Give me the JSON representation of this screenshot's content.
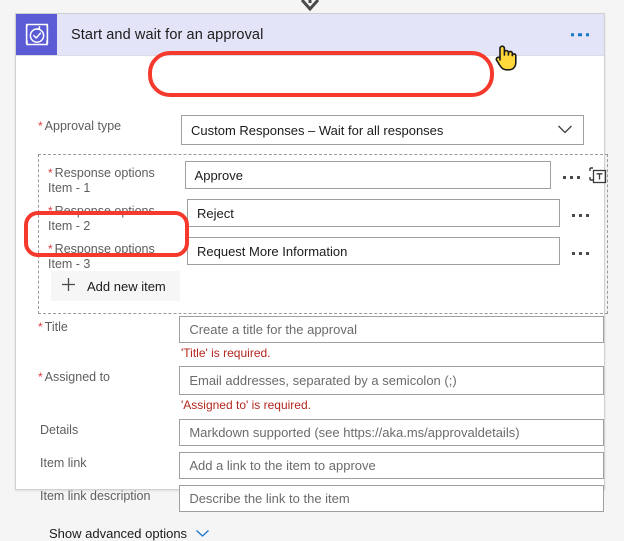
{
  "window": {
    "background_color": "#f5f5f5",
    "connector_arrow_icon": "arrow-down-icon"
  },
  "card": {
    "header": {
      "icon": "approval-check-icon",
      "icon_bg_color": "#5b5bd6",
      "bg_color": "#e4e4f8",
      "title": "Start and wait for an approval",
      "menu_icon": "ellipsis-horizontal-icon"
    },
    "approval_type": {
      "label": "Approval type",
      "required": true,
      "required_marker": "*",
      "value": "Custom Responses – Wait for all responses",
      "chevron_icon": "chevron-down-icon"
    },
    "response_options": {
      "rows": [
        {
          "label": "Response options\nItem - 1",
          "required_marker": "*",
          "value": "Approve",
          "ellipsis_icon": "ellipsis-horizontal-icon",
          "token_icon": "dynamic-content-text-icon"
        },
        {
          "label": "Response options\nItem - 2",
          "required_marker": "*",
          "value": "Reject",
          "ellipsis_icon": "ellipsis-horizontal-icon"
        },
        {
          "label": "Response options\nItem - 3",
          "required_marker": "*",
          "value": "Request More Information",
          "ellipsis_icon": "ellipsis-horizontal-icon"
        }
      ],
      "add_new_item": {
        "label": "Add new item",
        "icon": "plus-icon"
      }
    },
    "fields": [
      {
        "name": "title",
        "label": "Title",
        "required_marker": "*",
        "placeholder": "Create a title for the approval",
        "value": "",
        "error": "'Title' is required."
      },
      {
        "name": "assigned-to",
        "label": "Assigned to",
        "required_marker": "*",
        "placeholder": "Email addresses, separated by a semicolon (;)",
        "value": "",
        "error": "'Assigned to' is required."
      },
      {
        "name": "details",
        "label": "Details",
        "required_marker": "",
        "placeholder": "Markdown supported (see https://aka.ms/approvaldetails)",
        "value": "",
        "error": ""
      },
      {
        "name": "item-link",
        "label": "Item link",
        "required_marker": "",
        "placeholder": "Add a link to the item to approve",
        "value": "",
        "error": ""
      },
      {
        "name": "item-link-description",
        "label": "Item link description",
        "required_marker": "",
        "placeholder": "Describe the link to the item",
        "value": "",
        "error": ""
      }
    ],
    "advanced_options": {
      "label": "Show advanced options",
      "chevron_icon": "chevron-down-icon",
      "chevron_color": "#1776c9"
    }
  },
  "annotations": {
    "highlight_color": "#f5392d",
    "boxes": [
      {
        "name": "approval-type-highlight"
      },
      {
        "name": "add-new-item-highlight"
      }
    ],
    "cursor": "pointing-hand-cursor"
  }
}
